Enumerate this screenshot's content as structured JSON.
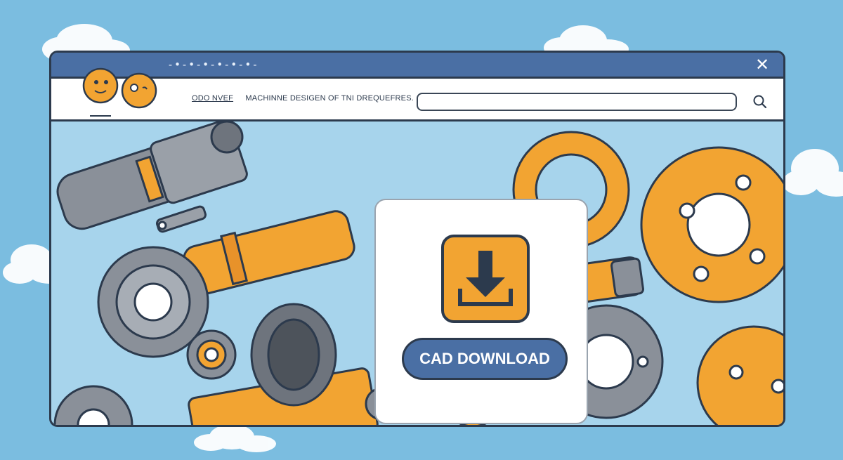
{
  "window": {
    "title_dots": "-•-•-•-•-•-•-"
  },
  "header": {
    "brand_mark": "ODO NVEF̲",
    "brand_title": "MACHINNE DESIGEN OF TNI DREQUEFRES.",
    "search": {
      "value": "",
      "placeholder": ""
    }
  },
  "modal": {
    "download_icon": "download-arrow-icon",
    "button_label": "CAD DOWNLOAD"
  },
  "colors": {
    "sky": "#7bbde0",
    "window_bg": "#a7d4ec",
    "titlebar": "#4a6fa4",
    "outline": "#2c3a4d",
    "accent_orange": "#f2a432",
    "gear_gray": "#8a9099"
  },
  "icons": {
    "close": "close-icon",
    "search": "search-icon",
    "logo": "gear-mascot-logo"
  }
}
